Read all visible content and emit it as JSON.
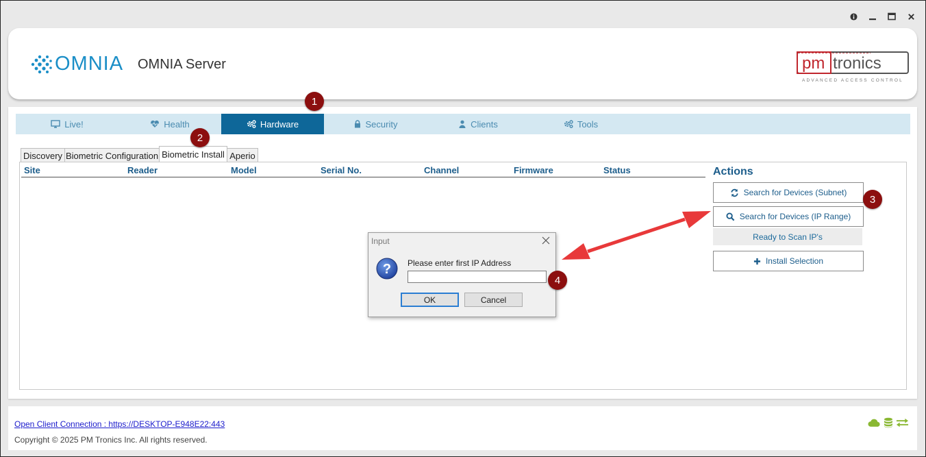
{
  "window": {
    "controls": [
      "info",
      "minimize",
      "maximize",
      "close"
    ]
  },
  "header": {
    "logo_text": "OMNIA",
    "title": "OMNIA Server",
    "brand_logo": {
      "main": "pmtronics",
      "tagline": "ADVANCED ACCESS CONTROL"
    }
  },
  "nav": {
    "tabs": [
      {
        "label": "Live!",
        "icon": "monitor-icon",
        "active": false
      },
      {
        "label": "Health",
        "icon": "heart-pulse-icon",
        "active": false
      },
      {
        "label": "Hardware",
        "icon": "gears-icon",
        "active": true
      },
      {
        "label": "Security",
        "icon": "lock-icon",
        "active": false
      },
      {
        "label": "Clients",
        "icon": "user-icon",
        "active": false
      },
      {
        "label": "Tools",
        "icon": "gears-icon",
        "active": false
      }
    ]
  },
  "subtabs": [
    {
      "label": "Discovery",
      "active": false
    },
    {
      "label": "Biometric Configuration",
      "active": false
    },
    {
      "label": "Biometric Install",
      "active": true
    },
    {
      "label": "Aperio",
      "active": false
    }
  ],
  "table": {
    "columns": [
      "Site",
      "Reader",
      "Model",
      "Serial No.",
      "Channel",
      "Firmware",
      "Status"
    ],
    "rows": []
  },
  "actions": {
    "title": "Actions",
    "search_subnet": "Search for Devices (Subnet)",
    "search_ip_range": "Search for Devices (IP Range)",
    "status": "Ready to Scan IP's",
    "install_selection": "Install Selection"
  },
  "dialog": {
    "title": "Input",
    "prompt": "Please enter first IP Address",
    "input_value": "",
    "ok": "OK",
    "cancel": "Cancel"
  },
  "callouts": [
    "1",
    "2",
    "3",
    "4"
  ],
  "footer": {
    "link": "Open Client Connection : https://DESKTOP-E948E22:443",
    "copyright": "Copyright © 2025 PM Tronics Inc. All rights reserved.",
    "status_icons": [
      "cloud-icon",
      "database-icon",
      "transfer-icon"
    ]
  },
  "colors": {
    "accent": "#0e6799",
    "nav_bg": "#d4e8f2",
    "heading": "#1c5d8b",
    "callout": "#8c0f0f",
    "arrow": "#e8393a",
    "footer_icons": "#8ab833"
  }
}
